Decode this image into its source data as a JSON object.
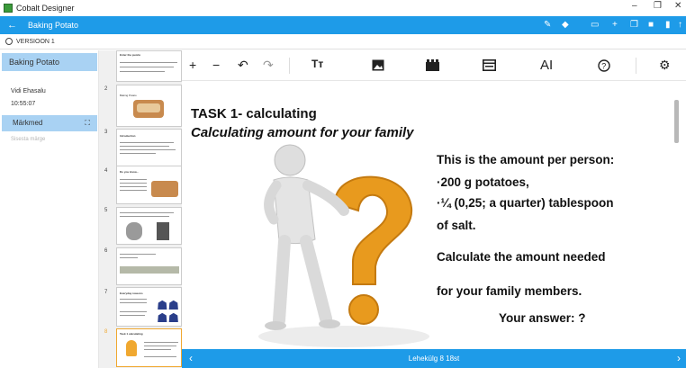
{
  "window": {
    "app_title": "Cobalt Designer",
    "controls": [
      "–",
      "❐",
      "✕"
    ]
  },
  "appbar": {
    "back_icon": "arrow-left-icon",
    "title": "Baking Potato"
  },
  "version": {
    "label": "VERSIOON 1"
  },
  "left_panel": {
    "title": "Baking Potato",
    "user": "Vidi Ehasalu",
    "time": "10:55:07",
    "notes_label": "Märkmed",
    "notes_placeholder": "Sisesta märge"
  },
  "thumbnails": [
    {
      "num": "",
      "title": "Enter the puzzle"
    },
    {
      "num": "2",
      "title": "Baking Potato"
    },
    {
      "num": "3",
      "title": "Introduction"
    },
    {
      "num": "4",
      "title": "Do you know..."
    },
    {
      "num": "5",
      "title": ""
    },
    {
      "num": "6",
      "title": ""
    },
    {
      "num": "7",
      "title": "Everyday reasons"
    },
    {
      "num": "8",
      "title": "Task 1 calculating"
    }
  ],
  "toolbar": {
    "icons": [
      "plus-icon",
      "minus-icon",
      "undo-icon",
      "redo-icon",
      "text-format-icon",
      "image-icon",
      "video-icon",
      "layout-icon",
      "text-cursor-icon",
      "quiz-icon",
      "gear-icon"
    ],
    "glyphs": {
      "plus": "+",
      "minus": "−",
      "undo": "↶",
      "redo": "↷",
      "text": "Tт",
      "textcursor": "AI"
    }
  },
  "slide": {
    "title": "TASK 1- calculating",
    "subtitle": "Calculating amount for your family",
    "line1": "This is the amount per person:",
    "line2": "·200 g potatoes,",
    "line3": "·¼  (0,25;  a quarter) tablespoon",
    "line4": "of salt.",
    "line5": "Calculate the amount needed",
    "line6": "for your family members.",
    "answer": "Your answer: ?"
  },
  "bottom": {
    "page_label": "Lehekülg 8 18st",
    "prev": "‹",
    "next": "›"
  },
  "colors": {
    "accent": "#1e9be8",
    "selection": "#a9d2f3",
    "active_thumb": "#f0a830"
  }
}
